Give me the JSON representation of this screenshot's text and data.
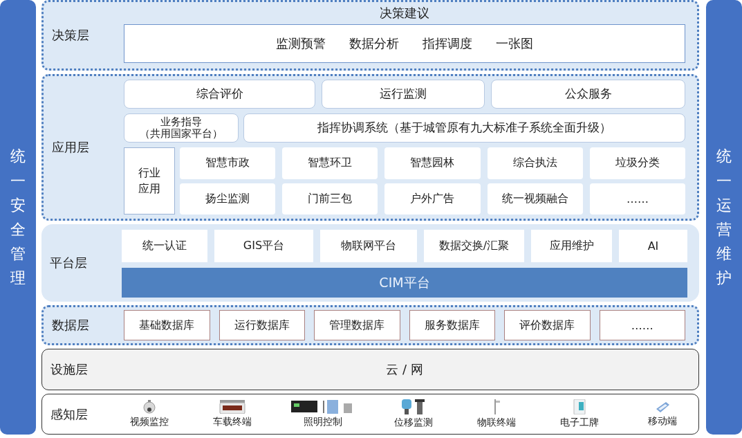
{
  "left_bar": {
    "title": "统一安全管理"
  },
  "right_bar": {
    "title": "统一运营维护"
  },
  "decision_layer": {
    "label": "决策层",
    "title": "决策建议",
    "items": [
      "监测预警",
      "数据分析",
      "指挥调度",
      "一张图"
    ]
  },
  "application_layer": {
    "label": "应用层",
    "top_items": [
      "综合评价",
      "运行监测",
      "公众服务"
    ],
    "guidance": {
      "title": "业务指导",
      "note": "（共用国家平台）"
    },
    "command_system": "指挥协调系统（基于城管原有九大标准子系统全面升级）",
    "industry": {
      "label": "行业应用",
      "items": [
        "智慧市政",
        "智慧环卫",
        "智慧园林",
        "综合执法",
        "垃圾分类",
        "扬尘监测",
        "门前三包",
        "户外广告",
        "统一视频融合",
        "……"
      ]
    }
  },
  "platform_layer": {
    "label": "平台层",
    "items": [
      "统一认证",
      "GIS平台",
      "物联网平台",
      "数据交换/汇聚",
      "应用维护",
      "AI"
    ],
    "base": "CIM平台"
  },
  "data_layer": {
    "label": "数据层",
    "items": [
      "基础数据库",
      "运行数据库",
      "管理数据库",
      "服务数据库",
      "评价数据库",
      "……"
    ]
  },
  "facility_layer": {
    "label": "设施层",
    "content": "云 / 网"
  },
  "sensing_layer": {
    "label": "感知层",
    "devices": [
      {
        "name": "视频监控",
        "kind": "camera"
      },
      {
        "name": "车载终端",
        "kind": "vehicle"
      },
      {
        "name": "照明控制",
        "kind": "lighting"
      },
      {
        "name": "位移监测",
        "kind": "sensor"
      },
      {
        "name": "物联终端",
        "kind": "pole"
      },
      {
        "name": "电子工牌",
        "kind": "badge"
      },
      {
        "name": "移动端",
        "kind": "handheld"
      }
    ]
  }
}
